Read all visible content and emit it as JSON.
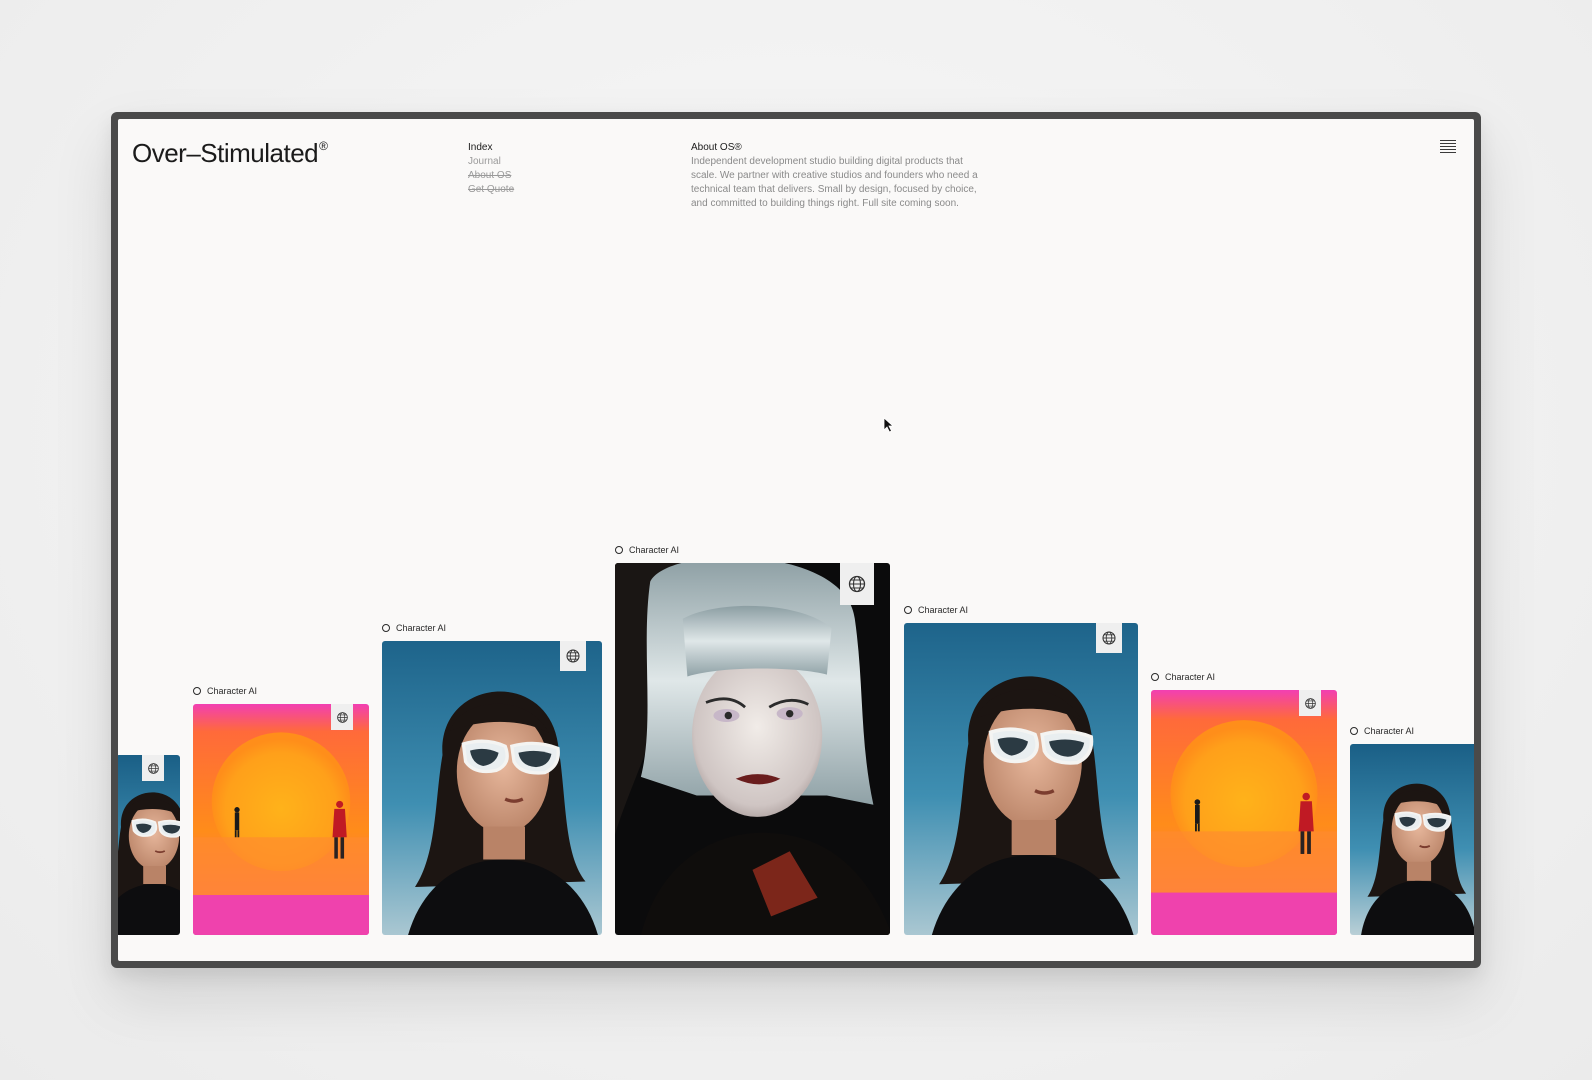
{
  "brand": {
    "name": "Over–Stimulated",
    "mark": "®"
  },
  "nav": {
    "items": [
      {
        "label": "Index",
        "state": "active"
      },
      {
        "label": "Journal",
        "state": "muted"
      },
      {
        "label": "About OS",
        "state": "struck"
      },
      {
        "label": "Get Quote",
        "state": "struck"
      }
    ]
  },
  "about": {
    "title": "About OS®",
    "description": "Independent development studio building digital products that scale. We partner with creative studios and founders who need a technical team that delivers. Small by design, focused by choice, and committed to building things right. Full site coming soon."
  },
  "menu": {
    "icon": "hamburger-icon"
  },
  "gallery": {
    "cards": [
      {
        "label": "",
        "image": "portrait-sunglasses"
      },
      {
        "label": "Character AI",
        "image": "desert-sunset"
      },
      {
        "label": "Character AI",
        "image": "portrait-sunglasses"
      },
      {
        "label": "Character AI",
        "image": "portrait-silver-hair"
      },
      {
        "label": "Character AI",
        "image": "portrait-sunglasses"
      },
      {
        "label": "Character AI",
        "image": "desert-sunset"
      },
      {
        "label": "Character AI",
        "image": "portrait-sunglasses"
      }
    ],
    "badge_icon": "globe-icon"
  },
  "colors": {
    "page_bg": "#faf9f8",
    "frame": "#4a4a4a",
    "text": "#1b1b1b",
    "muted": "#9a9a9a",
    "sunset_pink": "#f040b0",
    "sunset_orange": "#ff8a1c",
    "sky_blue": "#1f6f93"
  }
}
